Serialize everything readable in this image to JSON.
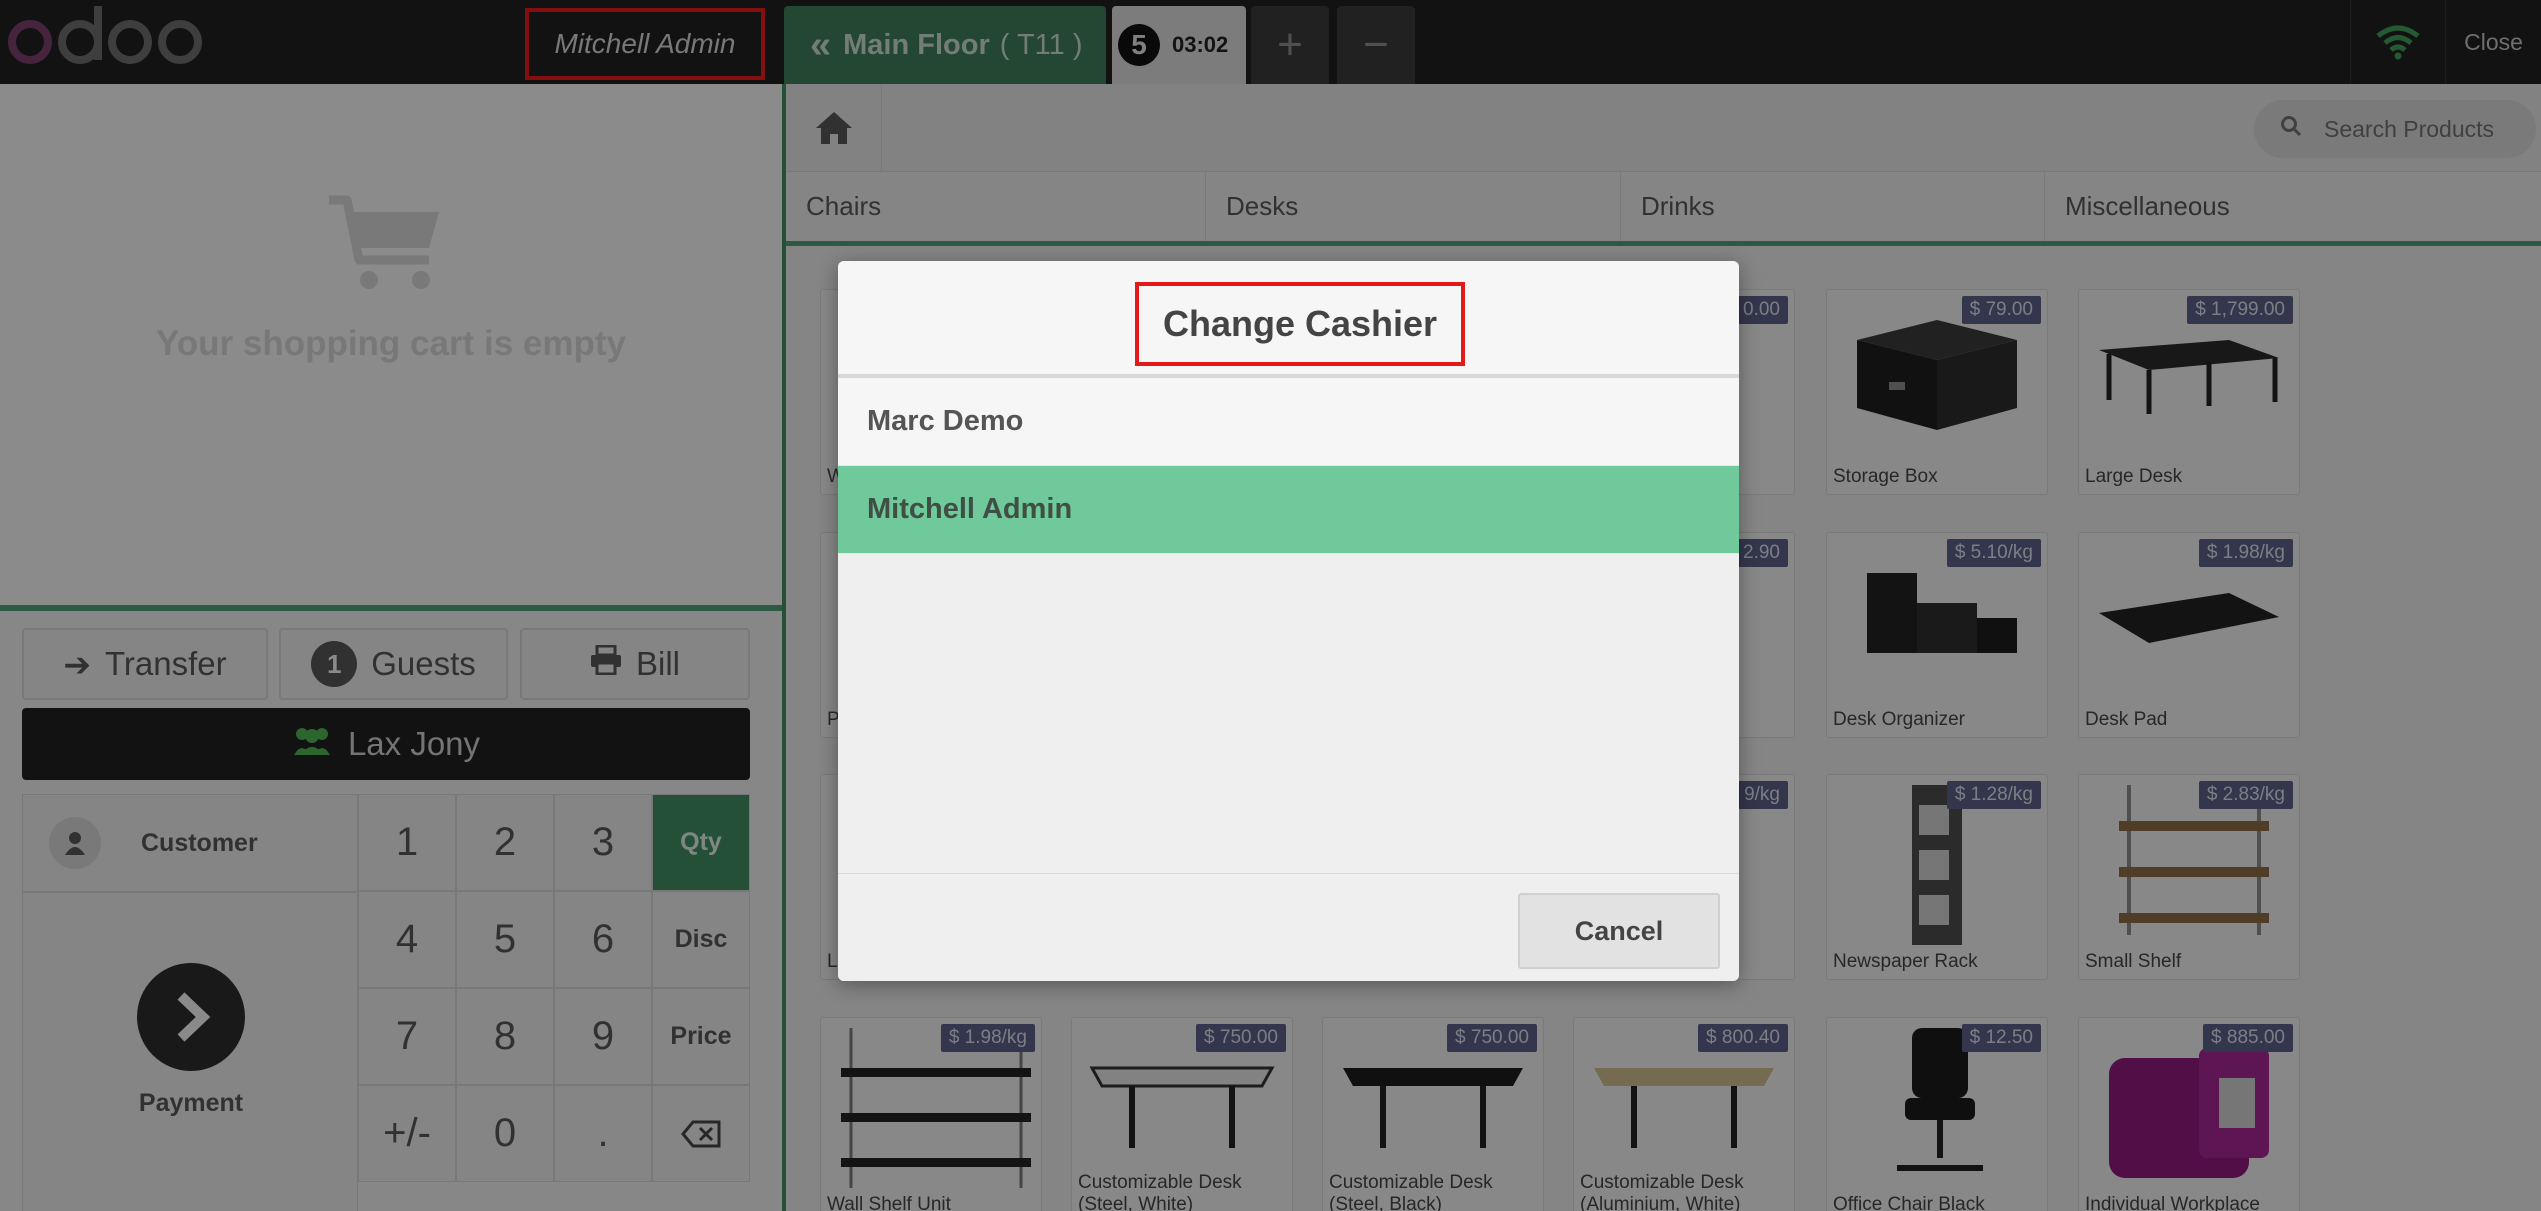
{
  "topbar": {
    "logo_text": "odoo",
    "cashier_name": "Mitchell Admin",
    "floor_label": "Main Floor",
    "table_label": "( T11 )",
    "order_number": "5",
    "order_time": "03:02",
    "add_order_symbol": "+",
    "remove_order_symbol": "−",
    "close_label": "Close"
  },
  "cart": {
    "empty_message": "Your shopping cart is empty"
  },
  "controls": {
    "transfer_label": "Transfer",
    "guests_count": "1",
    "guests_label": "Guests",
    "bill_label": "Bill",
    "customer_name": "Lax Jony"
  },
  "numpad": {
    "customer_label": "Customer",
    "payment_label": "Payment",
    "keys": [
      "1",
      "2",
      "3",
      "4",
      "5",
      "6",
      "7",
      "8",
      "9",
      "+/-",
      "0",
      "."
    ],
    "modes": [
      "Qty",
      "Disc",
      "Price"
    ],
    "active_mode": "Qty"
  },
  "products_header": {
    "search_placeholder": "Search Products",
    "categories": [
      "Chairs",
      "Desks",
      "Drinks",
      "Miscellaneous"
    ]
  },
  "products": [
    {
      "name": "Storage Box",
      "price": "$ 79.00"
    },
    {
      "name": "Large Desk",
      "price": "$ 1,799.00"
    },
    {
      "name": "Desk Organizer",
      "price": "$ 5.10/kg"
    },
    {
      "name": "Desk Pad",
      "price": "$ 1.98/kg"
    },
    {
      "name": "Newspaper Rack",
      "price": "$ 1.28/kg"
    },
    {
      "name": "Small Shelf",
      "price": "$ 2.83/kg"
    },
    {
      "name": "Wall Shelf Unit",
      "price": "$ 1.98/kg"
    },
    {
      "name": "Customizable Desk (Steel, White)",
      "price": "$ 750.00"
    },
    {
      "name": "Customizable Desk (Steel, Black)",
      "price": "$ 750.00"
    },
    {
      "name": "Customizable Desk (Aluminium, White)",
      "price": "$ 800.40"
    },
    {
      "name": "Office Chair Black",
      "price": "$ 12.50"
    },
    {
      "name": "Individual Workplace",
      "price": "$ 885.00"
    }
  ],
  "hidden_fragments": {
    "price_1": "0.00",
    "price_2": "2.90",
    "price_3": "9/kg",
    "name_1": "W",
    "name_2": "P",
    "name_3": "L"
  },
  "modal": {
    "title": "Change Cashier",
    "options": [
      "Marc Demo",
      "Mitchell Admin"
    ],
    "selected": "Mitchell Admin",
    "cancel_label": "Cancel"
  },
  "colors": {
    "accent_green": "#70c99a",
    "highlight_red": "#e21a1a",
    "price_badge": "#5b5e86"
  }
}
